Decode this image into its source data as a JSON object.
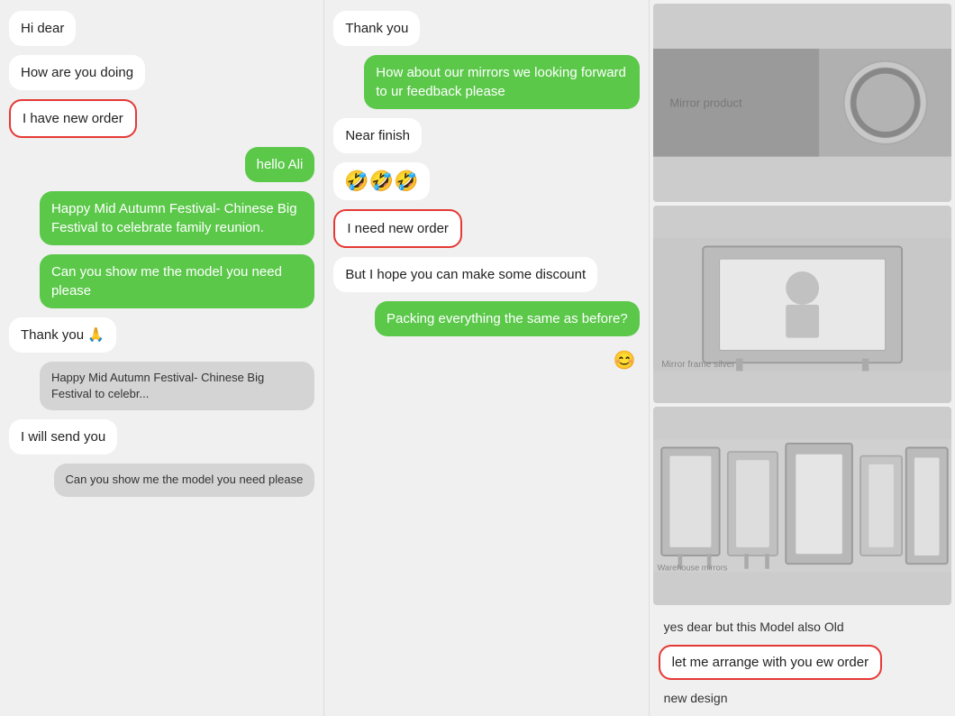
{
  "col1": {
    "messages": [
      {
        "id": "hi-dear",
        "text": "Hi dear",
        "type": "left-plain"
      },
      {
        "id": "how-are-you",
        "text": "How are you doing",
        "type": "left-plain"
      },
      {
        "id": "i-have-new-order",
        "text": "I have new order",
        "type": "left-outlined"
      },
      {
        "id": "hello-ali",
        "text": "hello Ali",
        "type": "right-green"
      },
      {
        "id": "happy-festival",
        "text": "Happy Mid Autumn Festival- Chinese Big Festival to celebrate family reunion.",
        "type": "right-green"
      },
      {
        "id": "can-you-show",
        "text": "Can you show me the model you need please",
        "type": "right-green"
      },
      {
        "id": "thank-you-pray",
        "text": "Thank you 🙏",
        "type": "left-plain"
      },
      {
        "id": "happy-festival-preview",
        "text": "Happy Mid Autumn Festival- Chinese Big Festival to celebr...",
        "type": "right-grey"
      },
      {
        "id": "i-will-send",
        "text": "I will send you",
        "type": "left-plain"
      },
      {
        "id": "can-you-show-preview",
        "text": "Can you show me the model you need please",
        "type": "right-grey"
      }
    ]
  },
  "col2": {
    "messages": [
      {
        "id": "thank-you",
        "text": "Thank you",
        "type": "left-plain"
      },
      {
        "id": "how-about-mirrors",
        "text": "How about our mirrors we looking forward to ur feedback please",
        "type": "right-green"
      },
      {
        "id": "near-finish",
        "text": "Near finish",
        "type": "left-plain"
      },
      {
        "id": "emoji-row",
        "text": "🤣🤣🤣",
        "type": "emoji"
      },
      {
        "id": "i-need-new-order",
        "text": "I need new order",
        "type": "left-outlined"
      },
      {
        "id": "but-hope-discount",
        "text": "But I hope you can make some discount",
        "type": "left-plain"
      },
      {
        "id": "packing-same",
        "text": "Packing everything the same as before?",
        "type": "right-green"
      },
      {
        "id": "emoji-bottom",
        "text": "😊",
        "type": "icon-bottom"
      }
    ]
  },
  "col3": {
    "images": [
      {
        "id": "mirror-img-1",
        "label": "mirror round silver"
      },
      {
        "id": "mirror-img-2",
        "label": "mirror frame silver standing"
      },
      {
        "id": "mirror-img-3",
        "label": "mirror frames warehouse"
      }
    ],
    "messages": [
      {
        "id": "yes-dear-old",
        "text": "yes dear but this Model also Old",
        "type": "plain"
      },
      {
        "id": "let-me-arrange",
        "text": "let me arrange with you ew order",
        "type": "outlined"
      },
      {
        "id": "new-design",
        "text": "new design",
        "type": "plain"
      }
    ]
  }
}
